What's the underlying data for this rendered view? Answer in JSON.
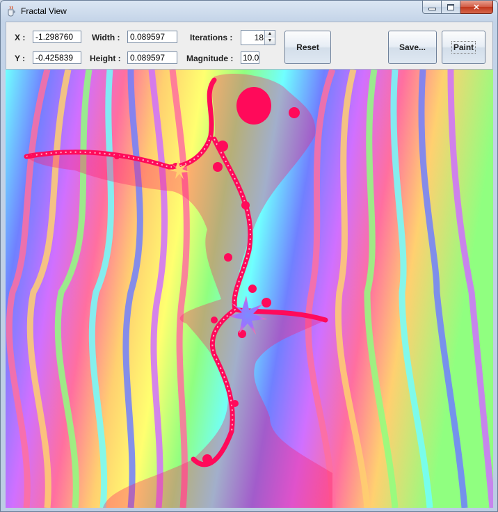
{
  "window": {
    "title": "Fractal View"
  },
  "controls": {
    "x_label": "X :",
    "x_value": "-1.298760",
    "y_label": "Y :",
    "y_value": "-0.425839",
    "width_label": "Width :",
    "width_value": "0.089597",
    "height_label": "Height :",
    "height_value": "0.089597",
    "iterations_label": "Iterations :",
    "iterations_value": "18",
    "magnitude_label": "Magnitude :",
    "magnitude_value": "10.0"
  },
  "buttons": {
    "reset": "Reset",
    "save": "Save...",
    "paint": "Paint"
  },
  "icons": {
    "app": "java-cup-icon",
    "minimize": "minimize-icon",
    "maximize": "maximize-icon",
    "close": "close-icon"
  },
  "colors": {
    "set_color": "#ff0a5a",
    "palette": [
      "#ff6fa0",
      "#ffd070",
      "#ffff70",
      "#90ff80",
      "#70ffff",
      "#7080ff",
      "#d070ff"
    ]
  }
}
